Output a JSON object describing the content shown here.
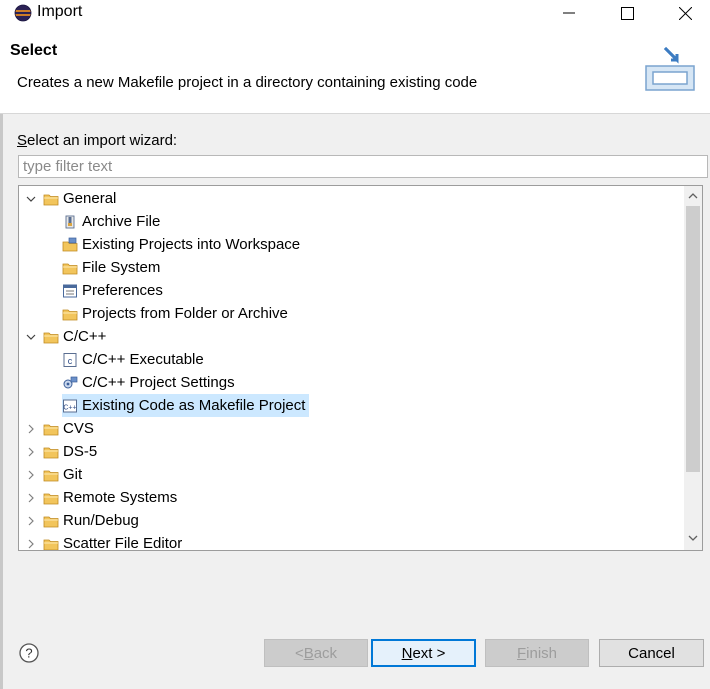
{
  "window": {
    "title": "Import",
    "icon": "eclipse-icon"
  },
  "header": {
    "title": "Select",
    "description": "Creates a new Makefile project in a directory containing existing code",
    "banner_icon": "import-banner-icon"
  },
  "wizard": {
    "label_mnemonic": "S",
    "label_rest": "elect an import wizard:",
    "filter_placeholder": "type filter text",
    "filter_value": ""
  },
  "tree": [
    {
      "label": "General",
      "level": 0,
      "expanded": true,
      "icon": "folder-icon"
    },
    {
      "label": "Archive File",
      "level": 1,
      "icon": "archive-icon"
    },
    {
      "label": "Existing Projects into Workspace",
      "level": 1,
      "icon": "projects-icon"
    },
    {
      "label": "File System",
      "level": 1,
      "icon": "folder-icon"
    },
    {
      "label": "Preferences",
      "level": 1,
      "icon": "preferences-icon"
    },
    {
      "label": "Projects from Folder or Archive",
      "level": 1,
      "icon": "folder-icon"
    },
    {
      "label": "C/C++",
      "level": 0,
      "expanded": true,
      "icon": "folder-icon"
    },
    {
      "label": "C/C++ Executable",
      "level": 1,
      "icon": "c-executable-icon"
    },
    {
      "label": "C/C++ Project Settings",
      "level": 1,
      "icon": "project-settings-icon"
    },
    {
      "label": "Existing Code as Makefile Project",
      "level": 1,
      "icon": "makefile-project-icon",
      "selected": true
    },
    {
      "label": "CVS",
      "level": 0,
      "expanded": false,
      "icon": "folder-icon"
    },
    {
      "label": "DS-5",
      "level": 0,
      "expanded": false,
      "icon": "folder-icon"
    },
    {
      "label": "Git",
      "level": 0,
      "expanded": false,
      "icon": "folder-icon"
    },
    {
      "label": "Remote Systems",
      "level": 0,
      "expanded": false,
      "icon": "folder-icon"
    },
    {
      "label": "Run/Debug",
      "level": 0,
      "expanded": false,
      "icon": "folder-icon"
    },
    {
      "label": "Scatter File Editor",
      "level": 0,
      "expanded": false,
      "icon": "folder-icon"
    }
  ],
  "buttons": {
    "back": {
      "prefix": "< ",
      "mnemonic": "B",
      "rest": "ack",
      "enabled": false
    },
    "next": {
      "mnemonic": "N",
      "rest": "ext >",
      "enabled": true
    },
    "finish": {
      "mnemonic": "F",
      "rest": "inish",
      "enabled": false
    },
    "cancel": {
      "label": "Cancel",
      "enabled": true
    }
  },
  "colors": {
    "selection": "#cce8ff",
    "accent": "#0078d7",
    "folder": "#f2c55c"
  }
}
